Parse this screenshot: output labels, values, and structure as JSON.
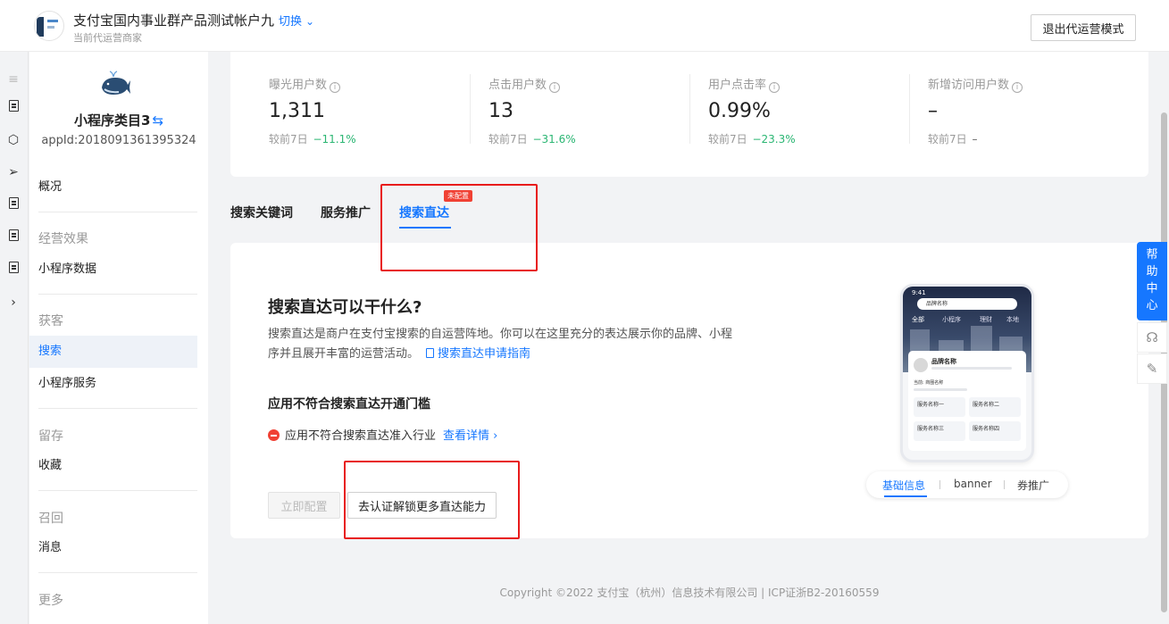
{
  "header": {
    "account_name": "支付宝国内事业群产品测试帐户九",
    "switch_label": "切换",
    "account_sub": "当前代运营商家",
    "exit_button": "退出代运营模式"
  },
  "sidebar": {
    "mini_program_name": "小程序类目3",
    "swap_glyph": "⇆",
    "appid": "appId:2018091361395324",
    "items": {
      "overview": "概况",
      "group_effect": "经营效果",
      "mp_data": "小程序数据",
      "group_acquire": "获客",
      "search": "搜索",
      "mp_service": "小程序服务",
      "group_retain": "留存",
      "favorite": "收藏",
      "group_recall": "召回",
      "message": "消息",
      "group_more": "更多"
    }
  },
  "stats": [
    {
      "label": "曝光用户数",
      "value": "1,311",
      "compare_prefix": "较前7日",
      "delta": "−11.1%"
    },
    {
      "label": "点击用户数",
      "value": "13",
      "compare_prefix": "较前7日",
      "delta": "−31.6%"
    },
    {
      "label": "用户点击率",
      "value": "0.99%",
      "compare_prefix": "较前7日",
      "delta": "−23.3%"
    },
    {
      "label": "新增访问用户数",
      "value": "–",
      "compare_prefix": "较前7日",
      "delta": "–"
    }
  ],
  "tabs": {
    "keywords": "搜索关键词",
    "service_promo": "服务推广",
    "direct": "搜索直达",
    "direct_badge": "未配置"
  },
  "content": {
    "title": "搜索直达可以干什么?",
    "description": "搜索直达是商户在支付宝搜索的自运营阵地。你可以在这里充分的表达展示你的品牌、小程序并且展开丰富的运营活动。",
    "guide_link": "搜索直达申请指南",
    "subtitle": "应用不符合搜索直达开通门槛",
    "warning": "应用不符合搜索直达准入行业",
    "detail_link": "查看详情",
    "detail_chevron": "›",
    "config_button": "立即配置",
    "unlock_button": "去认证解锁更多直达能力"
  },
  "phone_preview": {
    "time": "9:41",
    "search_text": "品牌名称",
    "tabs": [
      "全部",
      "小程序",
      "理财",
      "本地"
    ],
    "brand_title": "品牌名称",
    "current_label": "当前: 商圈名称",
    "services": [
      "服务名称一",
      "服务名称二",
      "服务名称三",
      "服务名称四"
    ]
  },
  "preview_tabs": {
    "basic": "基础信息",
    "banner": "banner",
    "coupon": "券推广"
  },
  "footer": "Copyright ©2022 支付宝（杭州）信息技术有限公司 | ICP证浙B2-20160559",
  "help": {
    "label": "帮助中心"
  },
  "colors": {
    "accent": "#1677ff",
    "positive_delta": "#2bb673",
    "highlight_box": "#e81b1b",
    "badge": "#f04134"
  }
}
